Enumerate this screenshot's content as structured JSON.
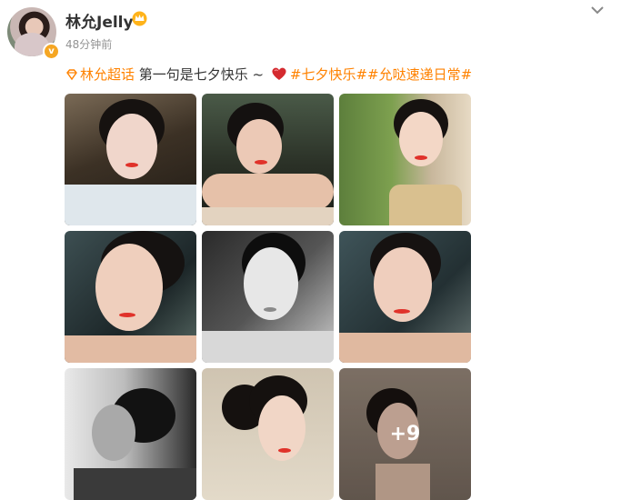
{
  "user": {
    "name": "林允Jelly",
    "time": "48分钟前"
  },
  "post": {
    "topic_super": "林允超话",
    "text": " 第一句是七夕快乐 ~ ",
    "hashtags": "#七夕快乐##允哒速递日常#"
  },
  "photos": {
    "count_more": "+9"
  },
  "colors": {
    "accent": "#ff8200",
    "badge": "#f5a623"
  }
}
